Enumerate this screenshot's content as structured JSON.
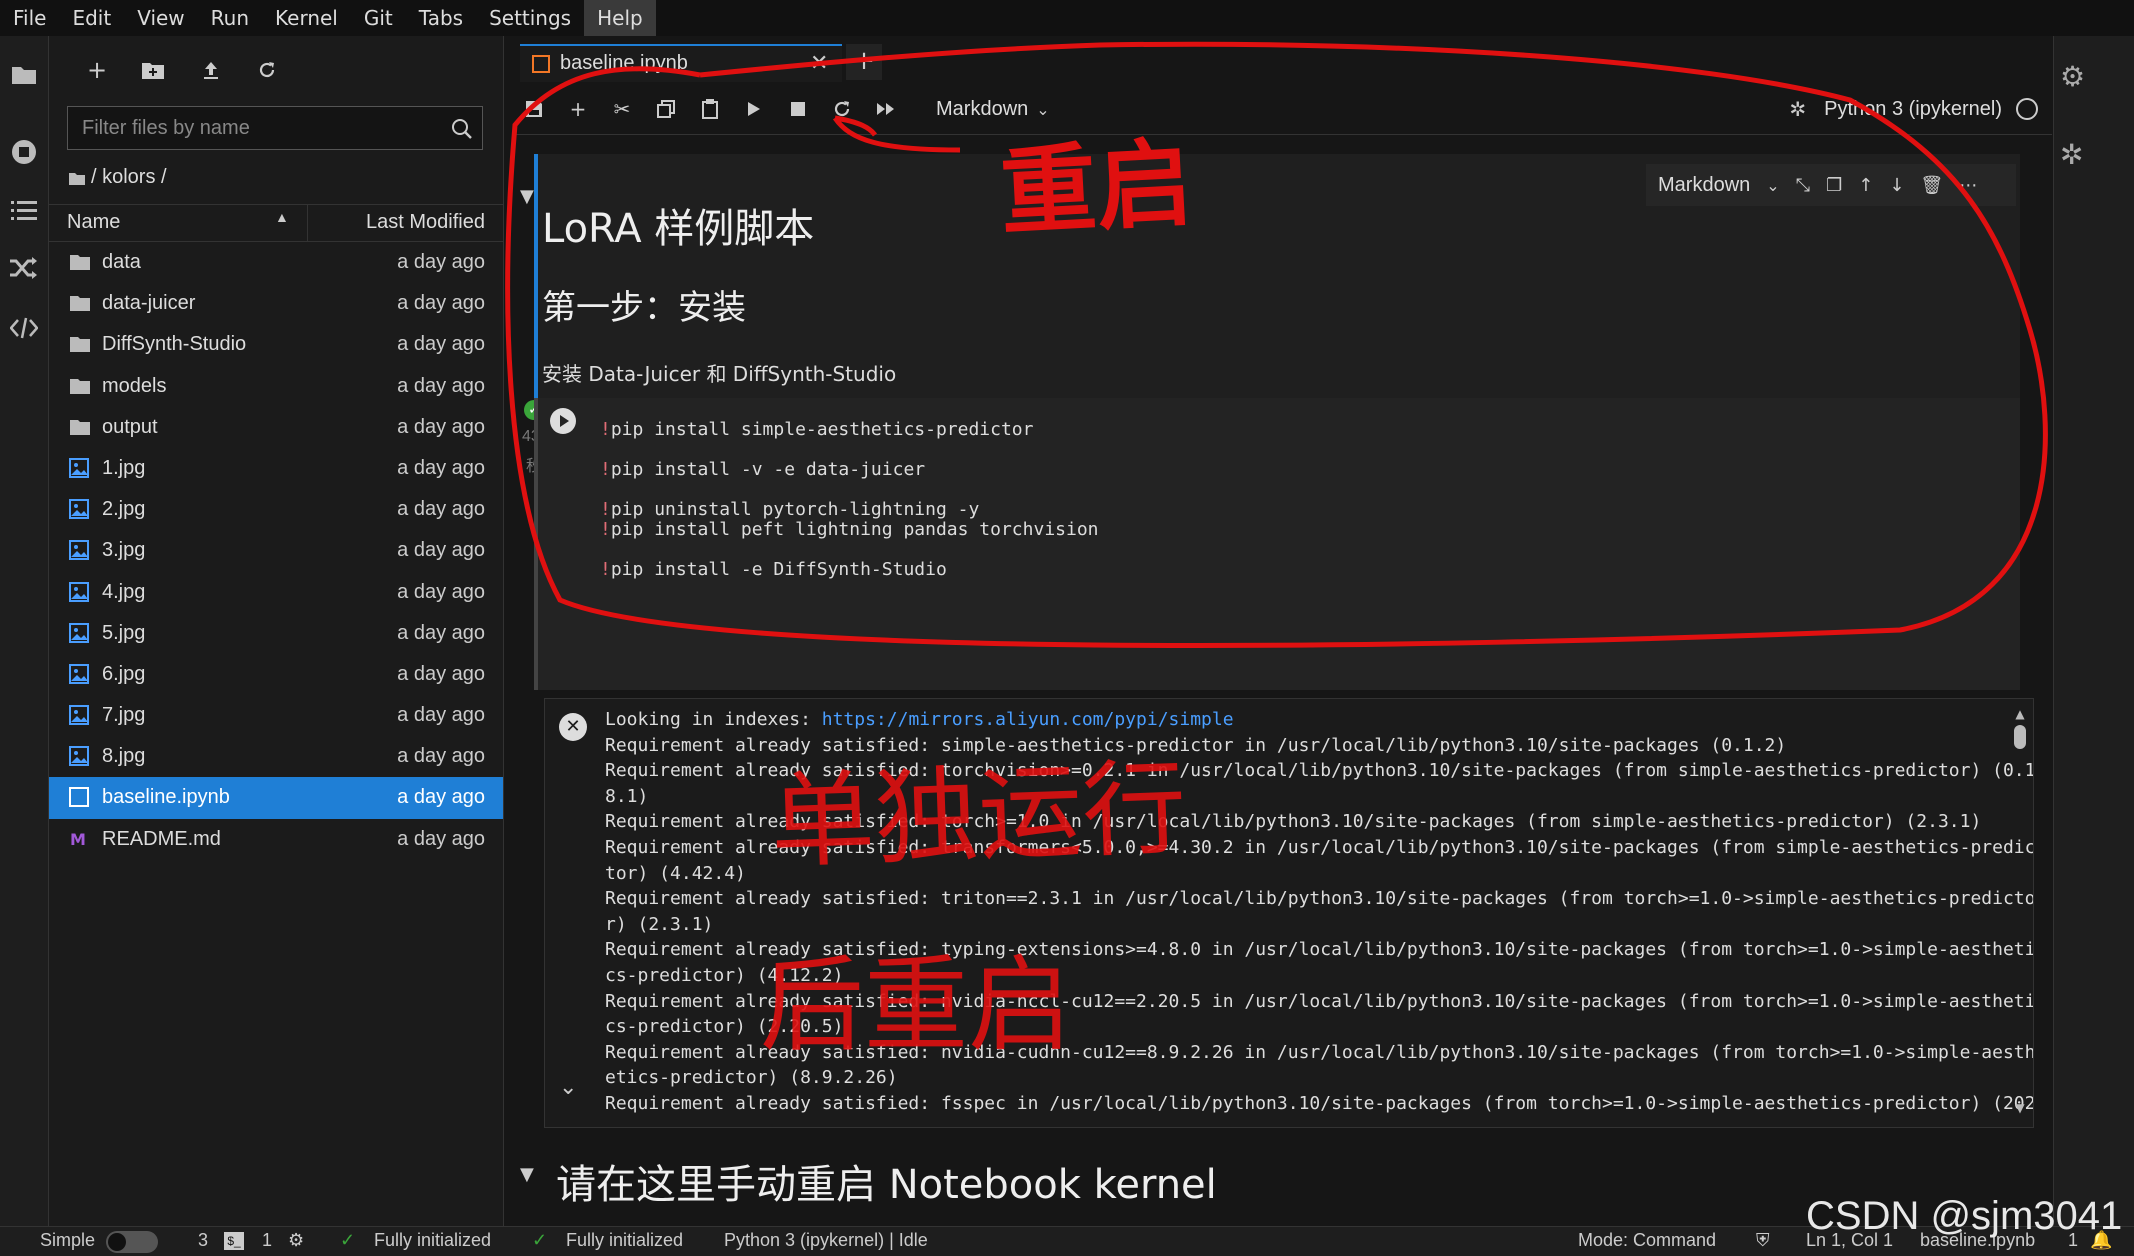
{
  "menu": [
    "File",
    "Edit",
    "View",
    "Run",
    "Kernel",
    "Git",
    "Tabs",
    "Settings",
    "Help"
  ],
  "menu_active": "Help",
  "filebrowser": {
    "filter_placeholder": "Filter files by name",
    "breadcrumb": "/ kolors /",
    "col_name": "Name",
    "col_modified": "Last Modified",
    "items": [
      {
        "name": "data",
        "type": "folder",
        "modified": "a day ago"
      },
      {
        "name": "data-juicer",
        "type": "folder",
        "modified": "a day ago"
      },
      {
        "name": "DiffSynth-Studio",
        "type": "folder",
        "modified": "a day ago"
      },
      {
        "name": "models",
        "type": "folder",
        "modified": "a day ago"
      },
      {
        "name": "output",
        "type": "folder",
        "modified": "a day ago"
      },
      {
        "name": "1.jpg",
        "type": "image",
        "modified": "a day ago"
      },
      {
        "name": "2.jpg",
        "type": "image",
        "modified": "a day ago"
      },
      {
        "name": "3.jpg",
        "type": "image",
        "modified": "a day ago"
      },
      {
        "name": "4.jpg",
        "type": "image",
        "modified": "a day ago"
      },
      {
        "name": "5.jpg",
        "type": "image",
        "modified": "a day ago"
      },
      {
        "name": "6.jpg",
        "type": "image",
        "modified": "a day ago"
      },
      {
        "name": "7.jpg",
        "type": "image",
        "modified": "a day ago"
      },
      {
        "name": "8.jpg",
        "type": "image",
        "modified": "a day ago"
      },
      {
        "name": "baseline.ipynb",
        "type": "notebook",
        "modified": "a day ago",
        "selected": true
      },
      {
        "name": "README.md",
        "type": "markdown",
        "modified": "a day ago"
      }
    ]
  },
  "notebook": {
    "tab_title": "baseline.ipynb",
    "cell_type": "Markdown",
    "kernel": "Python 3 (ipykernel)",
    "cell_toolbar_type": "Markdown",
    "md_h1": "LoRA 样例脚本",
    "md_h2": "第一步：安装",
    "md_p": "安装 Data-Juicer 和 DiffSynth-Studio",
    "exec_count": "43",
    "exec_unit": "秒",
    "code_lines": [
      {
        "bang": "!",
        "text": "pip install simple-aesthetics-predictor"
      },
      {
        "bang": "",
        "text": ""
      },
      {
        "bang": "!",
        "text": "pip install -v -e data-juicer"
      },
      {
        "bang": "",
        "text": ""
      },
      {
        "bang": "!",
        "text": "pip uninstall pytorch-lightning -y"
      },
      {
        "bang": "!",
        "text": "pip install peft lightning pandas torchvision"
      },
      {
        "bang": "",
        "text": ""
      },
      {
        "bang": "!",
        "text": "pip install -e DiffSynth-Studio"
      }
    ],
    "output_first_prefix": "Looking in indexes: ",
    "output_first_link": "https://mirrors.aliyun.com/pypi/simple",
    "output_lines": [
      "Requirement already satisfied: simple-aesthetics-predictor in /usr/local/lib/python3.10/site-packages (0.1.2)",
      "Requirement already satisfied: torchvision>=0.2.1 in /usr/local/lib/python3.10/site-packages (from simple-aesthetics-predictor) (0.1",
      "8.1)",
      "Requirement already satisfied: torch>=1.0 in /usr/local/lib/python3.10/site-packages (from simple-aesthetics-predictor) (2.3.1)",
      "Requirement already satisfied: transformers<5.0.0,>=4.30.2 in /usr/local/lib/python3.10/site-packages (from simple-aesthetics-predic",
      "tor) (4.42.4)",
      "Requirement already satisfied: triton==2.3.1 in /usr/local/lib/python3.10/site-packages (from torch>=1.0->simple-aesthetics-predicto",
      "r) (2.3.1)",
      "Requirement already satisfied: typing-extensions>=4.8.0 in /usr/local/lib/python3.10/site-packages (from torch>=1.0->simple-aestheti",
      "cs-predictor) (4.12.2)",
      "Requirement already satisfied: nvidia-nccl-cu12==2.20.5 in /usr/local/lib/python3.10/site-packages (from torch>=1.0->simple-aestheti",
      "cs-predictor) (2.20.5)",
      "Requirement already satisfied: nvidia-cudnn-cu12==8.9.2.26 in /usr/local/lib/python3.10/site-packages (from torch>=1.0->simple-aesth",
      "etics-predictor) (8.9.2.26)",
      "Requirement already satisfied: fsspec in /usr/local/lib/python3.10/site-packages (from torch>=1.0->simple-aesthetics-predictor) (202"
    ],
    "next_heading": "请在这里手动重启 Notebook kernel"
  },
  "annotations": {
    "restart_label": "重启",
    "run_alone_label": "单独运行",
    "then_restart_label": "后重启"
  },
  "status": {
    "mode_name": "Simple",
    "terminals": "3",
    "kernels": "1",
    "init1": "Fully initialized",
    "init2": "Fully initialized",
    "kernel_status": "Python 3 (ipykernel) | Idle",
    "mode": "Mode: Command",
    "cursor": "Ln 1, Col 1",
    "filename": "baseline.ipynb",
    "notif": "1"
  },
  "watermark": "CSDN @sjm3041",
  "colors": {
    "accent": "#1f7fd6",
    "annotation_red": "#e01010",
    "success": "#3aa53a"
  }
}
